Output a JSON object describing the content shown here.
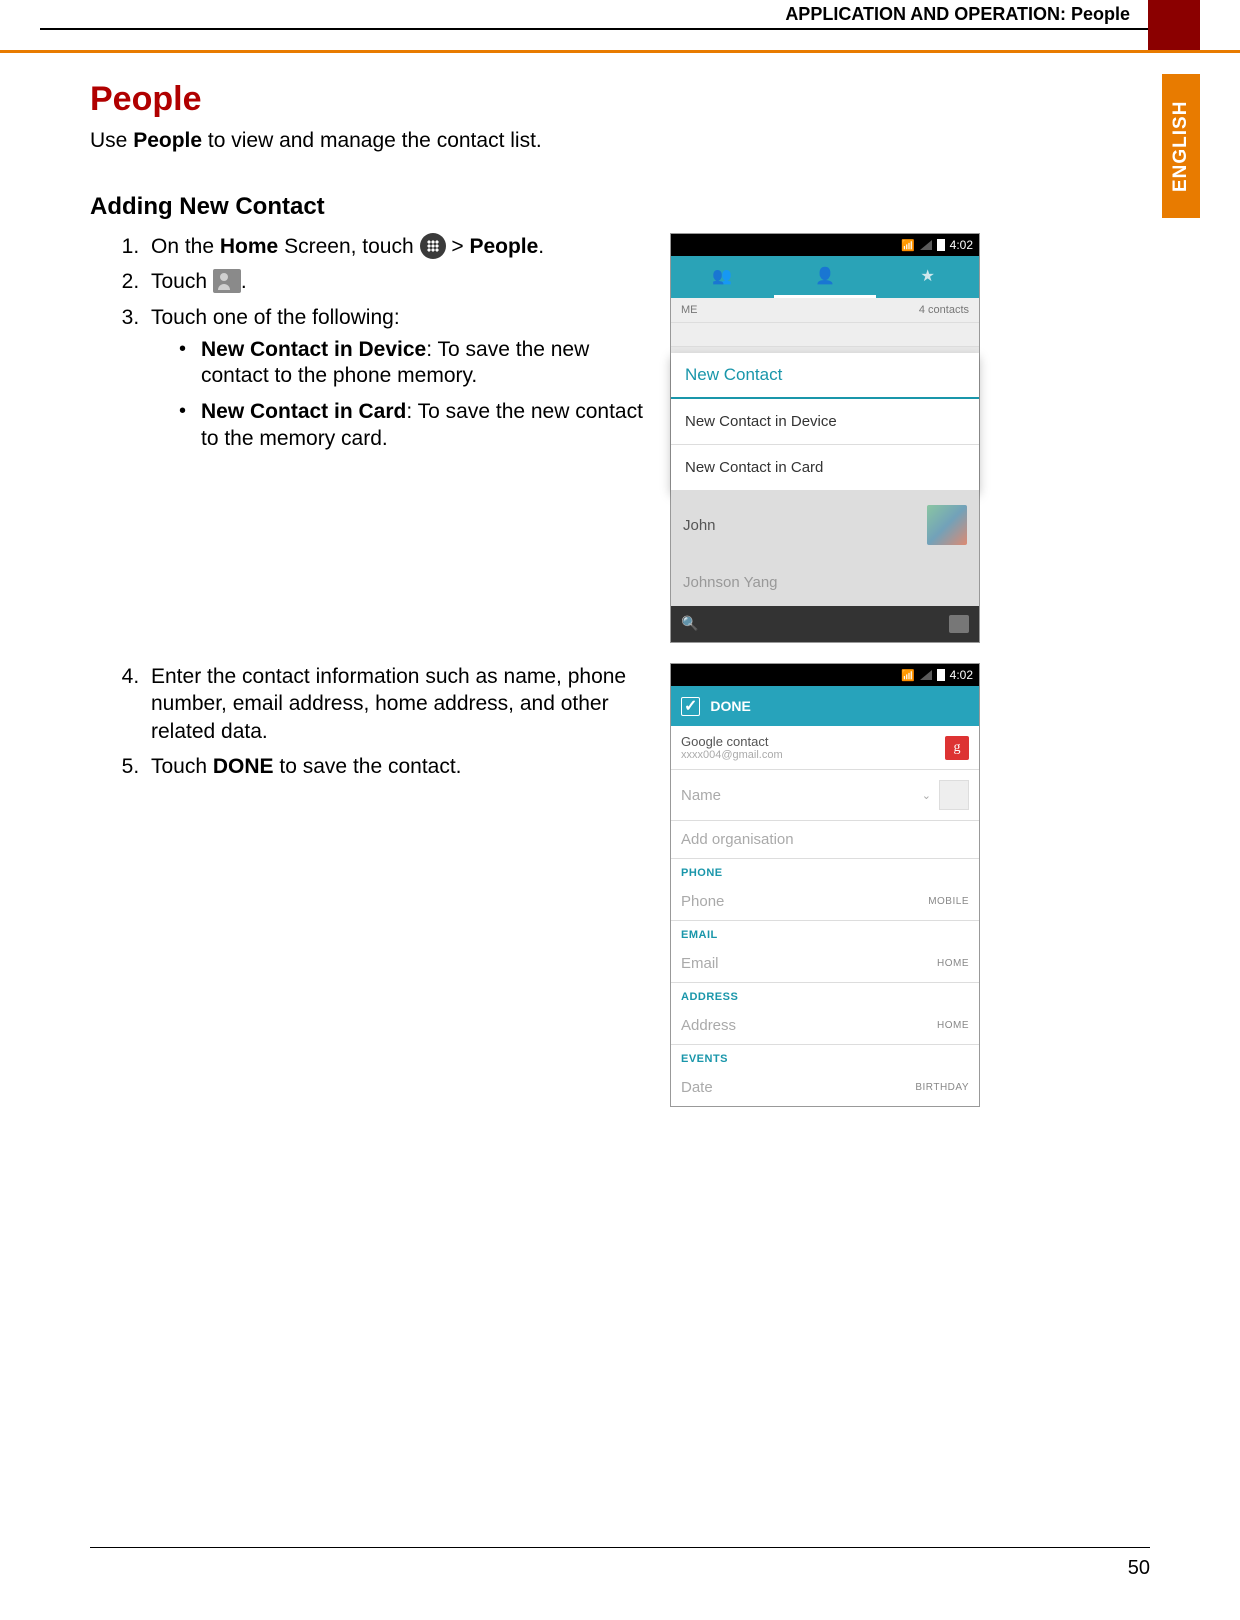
{
  "header": {
    "breadcrumb": "APPLICATION AND OPERATION: People",
    "language_tab": "ENGLISH"
  },
  "title": "People",
  "intro": {
    "pre": "Use ",
    "bold": "People",
    "post": " to view and manage the contact list."
  },
  "section": "Adding New Contact",
  "steps": {
    "s1": {
      "pre": "On the ",
      "b1": "Home",
      "mid": " Screen, touch ",
      "post_gt": "  > ",
      "b2": "People",
      "end": "."
    },
    "s2": {
      "pre": "Touch ",
      "end": "."
    },
    "s3": "Touch one of the following:",
    "s4": "Enter the contact information such as name, phone number, email address, home address, and other related data.",
    "s5": {
      "pre": "Touch ",
      "bold": "DONE",
      "post": " to save the contact."
    }
  },
  "bullets": {
    "b1": {
      "bold": "New Contact in Device",
      "rest": ": To save the new contact to the phone memory."
    },
    "b2": {
      "bold": "New Contact in Card",
      "rest": ": To save the new contact to the memory card."
    }
  },
  "phone1": {
    "time": "4:02",
    "me": "ME",
    "me_count": "4 contacts",
    "popup_title": "New Contact",
    "opt1": "New Contact in Device",
    "opt2": "New Contact in Card",
    "c1": "John",
    "c2": "Johnson Yang"
  },
  "phone2": {
    "time": "4:02",
    "done": "DONE",
    "acct_label": "Google contact",
    "acct_email": "xxxx004@gmail.com",
    "name": "Name",
    "org": "Add organisation",
    "sh_phone": "PHONE",
    "phone": "Phone",
    "tag_mobile": "MOBILE",
    "sh_email": "EMAIL",
    "email": "Email",
    "tag_home": "HOME",
    "sh_addr": "ADDRESS",
    "addr": "Address",
    "tag_home2": "HOME",
    "sh_events": "EVENTS",
    "date": "Date",
    "tag_bday": "BIRTHDAY"
  },
  "page_number": "50"
}
